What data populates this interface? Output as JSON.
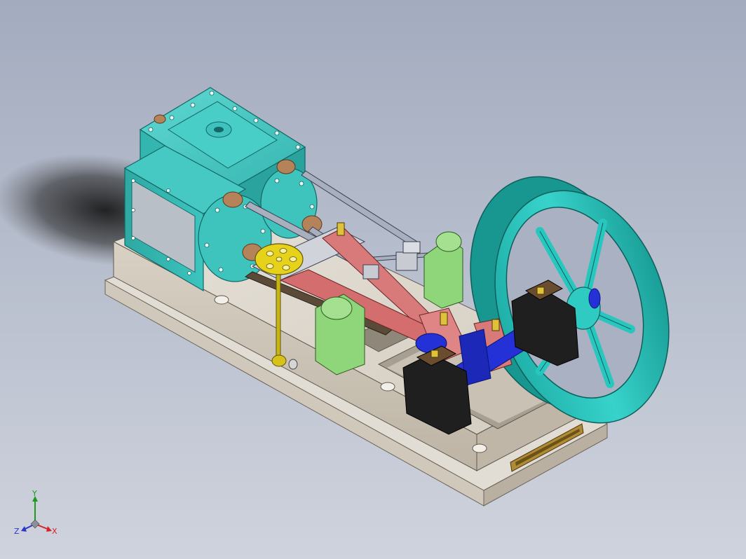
{
  "viewport": {
    "background": "#b6bdcc",
    "model": {
      "colors": {
        "base": "#dcd6cc",
        "cylinder": "#3fc2bd",
        "flywheel": "#27c7bf",
        "crank": "#2431d6",
        "bearing_block": "#1f1f1f",
        "connecting_rod": "#d97a7a",
        "guide_bracket": "#8fd67a",
        "governor_wheel": "#e6d21b",
        "flange": "#b5835a",
        "nameplate": "#b08a36"
      }
    },
    "triad": {
      "labels": {
        "x": "X",
        "y": "Y",
        "z": "Z"
      },
      "colors": {
        "x": "#d22424",
        "y": "#1e9a1e",
        "z": "#2a37c8"
      }
    }
  }
}
